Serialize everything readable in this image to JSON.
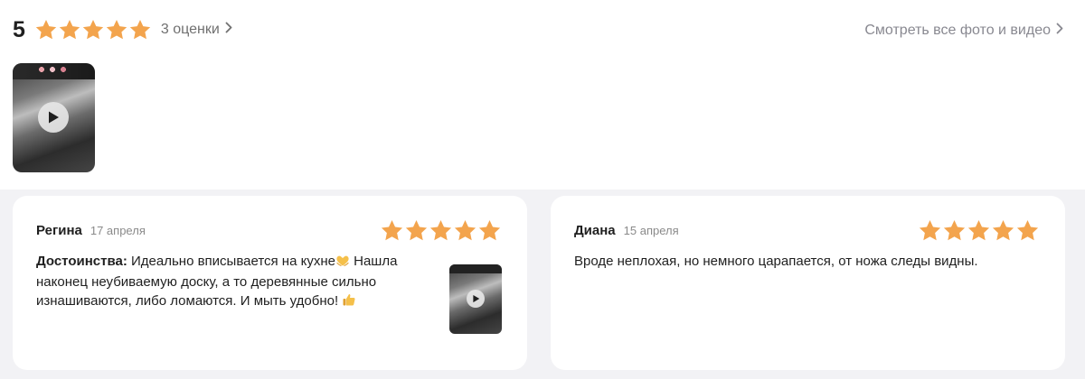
{
  "summary": {
    "rating": "5",
    "stars": 5,
    "count_label": "3 оценки",
    "see_all_label": "Смотреть все фото и видео"
  },
  "colors": {
    "star": "#f3a44d",
    "background": "#f2f2f5",
    "card": "#ffffff"
  },
  "icons": {
    "star": "star-icon",
    "chevron": "chevron-right-icon",
    "play": "play-icon",
    "love": "heart-hands-emoji",
    "thumbs": "thumbs-up-emoji"
  },
  "reviews": [
    {
      "author": "Регина",
      "date": "17 апреля",
      "stars": 5,
      "label": "Достоинства:",
      "text_part1": " Идеально вписывается на кухне",
      "text_part2": " Нашла наконец неубиваемую доску, а то деревянные сильно изнашиваются, либо ломаются. И мыть удобно! "
    },
    {
      "author": "Диана",
      "date": "15 апреля",
      "stars": 5,
      "text": "Вроде неплохая, но немного царапается, от ножа следы видны."
    }
  ]
}
